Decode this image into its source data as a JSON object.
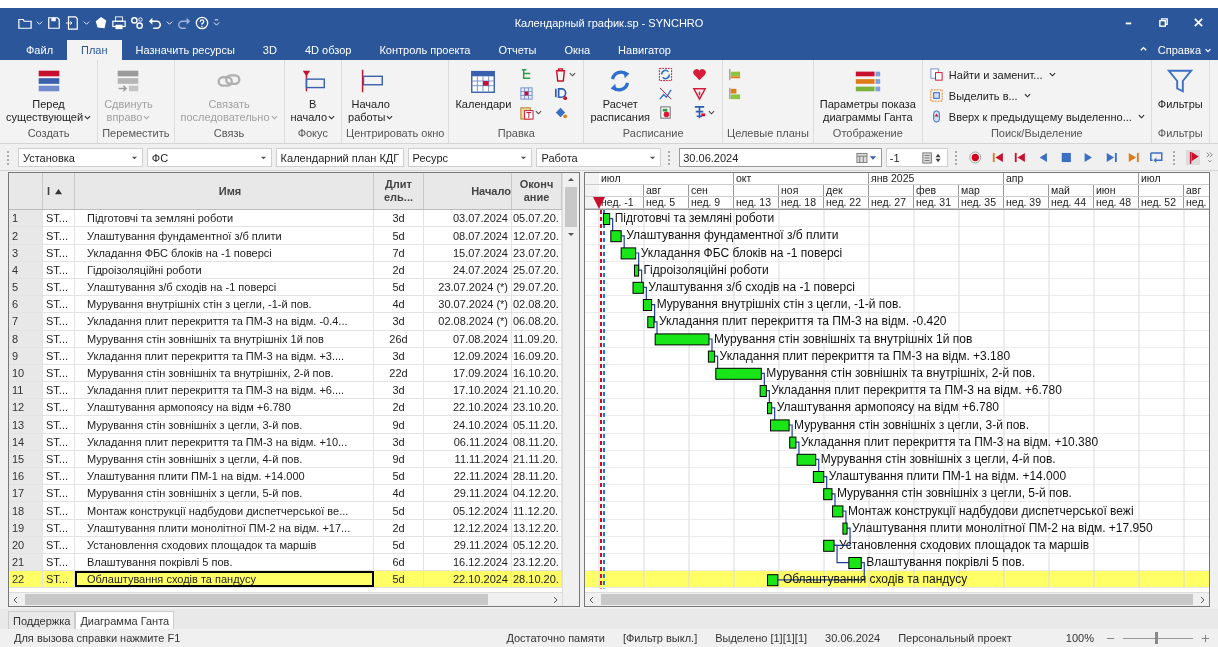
{
  "window": {
    "title": "Календарный график.sp - SYNCHRO"
  },
  "menu_tabs": [
    {
      "label": "Файл",
      "selected": false
    },
    {
      "label": "План",
      "selected": true
    },
    {
      "label": "Назначить ресурсы",
      "selected": false
    },
    {
      "label": "3D",
      "selected": false
    },
    {
      "label": "4D обзор",
      "selected": false
    },
    {
      "label": "Контроль проекта",
      "selected": false
    },
    {
      "label": "Отчеты",
      "selected": false
    },
    {
      "label": "Окна",
      "selected": false
    },
    {
      "label": "Навигатор",
      "selected": false
    }
  ],
  "help_menu": "Справка",
  "ribbon": [
    {
      "label": "Создать",
      "buttons": [
        {
          "kind": "large",
          "lines": [
            "Перед",
            "существующей"
          ],
          "dropdown": true,
          "disabled": false
        }
      ]
    },
    {
      "label": "Переместить",
      "buttons": [
        {
          "kind": "large",
          "lines": [
            "Сдвинуть",
            "вправо"
          ],
          "dropdown": true,
          "disabled": true
        }
      ]
    },
    {
      "label": "Связь",
      "buttons": [
        {
          "kind": "large",
          "lines": [
            "Связать",
            "последовательно"
          ],
          "dropdown": true,
          "disabled": true
        }
      ]
    },
    {
      "label": "Фокус",
      "buttons": [
        {
          "kind": "large",
          "lines": [
            "В",
            "начало"
          ],
          "dropdown": true,
          "disabled": false
        }
      ]
    },
    {
      "label": "Центрировать окно",
      "buttons": [
        {
          "kind": "large",
          "lines": [
            "Начало",
            "работы"
          ],
          "dropdown": true,
          "disabled": false
        }
      ]
    },
    {
      "label": "Правка",
      "buttons": [
        {
          "kind": "large",
          "lines": [
            "Календари"
          ],
          "dropdown": false,
          "disabled": false
        }
      ]
    },
    {
      "label": "Расписание",
      "buttons": [
        {
          "kind": "large",
          "lines": [
            "Расчет",
            "расписания"
          ],
          "dropdown": false,
          "disabled": false
        }
      ]
    },
    {
      "label": "Целевые планы"
    },
    {
      "label": "Отображение",
      "buttons": [
        {
          "kind": "large",
          "lines": [
            "Параметры показа",
            "диаграммы Ганта"
          ],
          "dropdown": false,
          "disabled": false
        }
      ]
    },
    {
      "label": "Поиск/Выделение",
      "buttons": [
        {
          "kind": "small",
          "lines": [
            "Найти и заменит..."
          ],
          "dropdown": true,
          "disabled": false
        },
        {
          "kind": "small",
          "lines": [
            "Выделить в..."
          ],
          "dropdown": true,
          "disabled": false
        },
        {
          "kind": "small",
          "lines": [
            "Вверх к предыдущему выделенно..."
          ],
          "dropdown": true,
          "disabled": false
        }
      ]
    },
    {
      "label": "Фильтры",
      "buttons": [
        {
          "kind": "large",
          "lines": [
            "Фильтры"
          ],
          "dropdown": false,
          "disabled": false
        }
      ]
    }
  ],
  "toolbar": {
    "filters": [
      "Установка",
      "ФС",
      "Календарний план КДГ",
      "Ресурс",
      "Работа"
    ],
    "date": "30.06.2024",
    "step": "-1"
  },
  "table": {
    "columns": [
      {
        "lines": [
          "I"
        ],
        "sorted": true
      },
      {
        "lines": [
          "Имя"
        ],
        "sorted": false
      },
      {
        "lines": [
          "Длит",
          "ель..."
        ],
        "sorted": false
      },
      {
        "lines": [
          "Начало"
        ],
        "sorted": false
      },
      {
        "lines": [
          "Оконч",
          "ание"
        ],
        "sorted": false
      }
    ],
    "rows": [
      {
        "num": "1",
        "id": "ST...",
        "name": "Підготовчі та земляні роботи",
        "duration": "3d",
        "start": "03.07.2024",
        "end": "05.07.20.",
        "bar_label": "Підготовчі та земляні роботи",
        "selected": false
      },
      {
        "num": "2",
        "id": "ST...",
        "name": "Улаштування фундаментної з/б плити",
        "duration": "5d",
        "start": "08.07.2024",
        "end": "12.07.20.",
        "bar_label": "Улаштування фундаментної з/б плити",
        "selected": false
      },
      {
        "num": "3",
        "id": "ST...",
        "name": "Укладання ФБС блоків на -1 поверсі",
        "duration": "7d",
        "start": "15.07.2024",
        "end": "23.07.20.",
        "bar_label": "Укладання ФБС блоків на -1 поверсі",
        "selected": false
      },
      {
        "num": "4",
        "id": "ST...",
        "name": "Гідроізоляційні роботи",
        "duration": "2d",
        "start": "24.07.2024",
        "end": "25.07.20.",
        "bar_label": "Гідроізоляційні роботи",
        "selected": false
      },
      {
        "num": "5",
        "id": "ST...",
        "name": "Улаштування з/б сходів на -1 поверсі",
        "duration": "5d",
        "start": "23.07.2024 (*)",
        "end": "29.07.20.",
        "bar_label": "Улаштування з/б сходів на -1 поверсі",
        "selected": false
      },
      {
        "num": "6",
        "id": "ST...",
        "name": "Мурування внутрішніх стін з цегли,  -1-й пов.",
        "duration": "4d",
        "start": "30.07.2024 (*)",
        "end": "02.08.20.",
        "bar_label": "Мурування внутрішніх стін з цегли,  -1-й пов.",
        "selected": false
      },
      {
        "num": "7",
        "id": "ST...",
        "name": "Укладання плит перекриття та ПМ-3 на відм. -0.4...",
        "duration": "3d",
        "start": "02.08.2024 (*)",
        "end": "06.08.20.",
        "bar_label": "Укладання плит перекриття та ПМ-3 на відм. -0.420",
        "selected": false
      },
      {
        "num": "8",
        "id": "ST...",
        "name": "Мурування стін зовнішніх та внутрішніх 1й пов",
        "duration": "26d",
        "start": "07.08.2024",
        "end": "11.09.20.",
        "bar_label": "Мурування стін зовнішніх та внутрішніх 1й пов",
        "selected": false
      },
      {
        "num": "9",
        "id": "ST...",
        "name": "Укладання плит перекриття та ПМ-3 на відм. +3....",
        "duration": "3d",
        "start": "12.09.2024",
        "end": "16.09.20.",
        "bar_label": "Укладання плит перекриття та ПМ-3 на відм. +3.180",
        "selected": false
      },
      {
        "num": "10",
        "id": "ST...",
        "name": "Мурування стін зовнішніх та внутрішніх, 2-й пов.",
        "duration": "22d",
        "start": "17.09.2024",
        "end": "16.10.20.",
        "bar_label": "Мурування стін зовнішніх та внутрішніх, 2-й пов.",
        "selected": false
      },
      {
        "num": "11",
        "id": "ST...",
        "name": "Укладання плит перекриття та ПМ-3 на відм. +6....",
        "duration": "3d",
        "start": "17.10.2024",
        "end": "21.10.20.",
        "bar_label": "Укладання плит перекриття та ПМ-3 на відм. +6.780",
        "selected": false
      },
      {
        "num": "12",
        "id": "ST...",
        "name": "Улаштування армопоясу на відм +6.780",
        "duration": "2d",
        "start": "22.10.2024",
        "end": "23.10.20.",
        "bar_label": "Улаштування армопоясу на відм +6.780",
        "selected": false
      },
      {
        "num": "13",
        "id": "ST...",
        "name": "Мурування стін зовнішніх з цегли, 3-й пов.",
        "duration": "9d",
        "start": "24.10.2024",
        "end": "05.11.20.",
        "bar_label": "Мурування стін зовнішніх з цегли, 3-й пов.",
        "selected": false
      },
      {
        "num": "14",
        "id": "ST...",
        "name": "Укладання плит перекриття та ПМ-3 на відм. +10...",
        "duration": "3d",
        "start": "06.11.2024",
        "end": "08.11.20.",
        "bar_label": "Укладання плит перекриття та ПМ-3 на відм. +10.380",
        "selected": false
      },
      {
        "num": "15",
        "id": "ST...",
        "name": "Мурування стін зовнішніх з цегли, 4-й пов.",
        "duration": "9d",
        "start": "11.11.2024",
        "end": "21.11.20.",
        "bar_label": "Мурування стін зовнішніх з цегли, 4-й пов.",
        "selected": false
      },
      {
        "num": "16",
        "id": "ST...",
        "name": "Улаштування плити ПМ-1 на відм. +14.000",
        "duration": "5d",
        "start": "22.11.2024",
        "end": "28.11.20.",
        "bar_label": "Улаштування плити ПМ-1 на відм. +14.000",
        "selected": false
      },
      {
        "num": "17",
        "id": "ST...",
        "name": "Мурування стін зовнішніх з цегли, 5-й пов.",
        "duration": "4d",
        "start": "29.11.2024",
        "end": "04.12.20.",
        "bar_label": "Мурування стін зовнішніх з цегли, 5-й пов.",
        "selected": false
      },
      {
        "num": "18",
        "id": "ST...",
        "name": "Монтаж конструкції надбудови диспетчерської ве...",
        "duration": "5d",
        "start": "05.12.2024",
        "end": "11.12.20.",
        "bar_label": "Монтаж конструкції надбудови диспетчерської вежі",
        "selected": false
      },
      {
        "num": "19",
        "id": "ST...",
        "name": "Улаштування плити монолітної ПМ-2 на відм. +17...",
        "duration": "2d",
        "start": "12.12.2024",
        "end": "13.12.20.",
        "bar_label": "Улаштування плити монолітної ПМ-2 на відм. +17.950",
        "selected": false
      },
      {
        "num": "20",
        "id": "ST...",
        "name": "Установлення сходових площадок та маршів",
        "duration": "5d",
        "start": "29.11.2024",
        "end": "05.12.20.",
        "bar_label": "Установлення сходових площадок та маршів",
        "selected": false
      },
      {
        "num": "21",
        "id": "ST...",
        "name": "Влаштування покрівлі 5 пов.",
        "duration": "6d",
        "start": "16.12.2024",
        "end": "23.12.20.",
        "bar_label": "Влаштування покрівлі 5 пов.",
        "selected": false
      },
      {
        "num": "22",
        "id": "ST...",
        "name": "Облаштування сходів та пандусу",
        "duration": "5d",
        "start": "22.10.2024",
        "end": "28.10.20.",
        "bar_label": "Облаштування сходів та пандусу",
        "selected": true
      }
    ]
  },
  "timescale": {
    "quarters": [
      {
        "label": "июл",
        "months": [
          "авг",
          "сен"
        ]
      },
      {
        "label": "окт",
        "months": [
          "ноя",
          "дек"
        ]
      },
      {
        "label": "янв 2025",
        "months": [
          "фев",
          "мар"
        ]
      },
      {
        "label": "апр",
        "months": [
          "май",
          "июн"
        ]
      },
      {
        "label": "июл",
        "months": [
          "авг"
        ]
      }
    ],
    "weeks": [
      "нед. -1",
      "нед. 5",
      "нед. 9",
      "нед. 13",
      "нед. 18",
      "нед. 22",
      "нед. 27",
      "нед. 31",
      "нед. 35",
      "нед. 39",
      "нед. 44",
      "нед. 48",
      "нед. 52",
      "нед."
    ]
  },
  "doc_tabs": [
    {
      "label": "Поддержка",
      "selected": false
    },
    {
      "label": "Диаграмма Ганта",
      "selected": true
    }
  ],
  "status_bar": {
    "help": "Для вызова справки нажмите F1",
    "items": [
      "Достаточно памяти",
      "[Фильтр выкл.]",
      "Выделено [1][1][1]",
      "30.06.2024",
      "Персональный проект"
    ],
    "zoom": {
      "reading": "100%",
      "level": 0.45
    }
  }
}
